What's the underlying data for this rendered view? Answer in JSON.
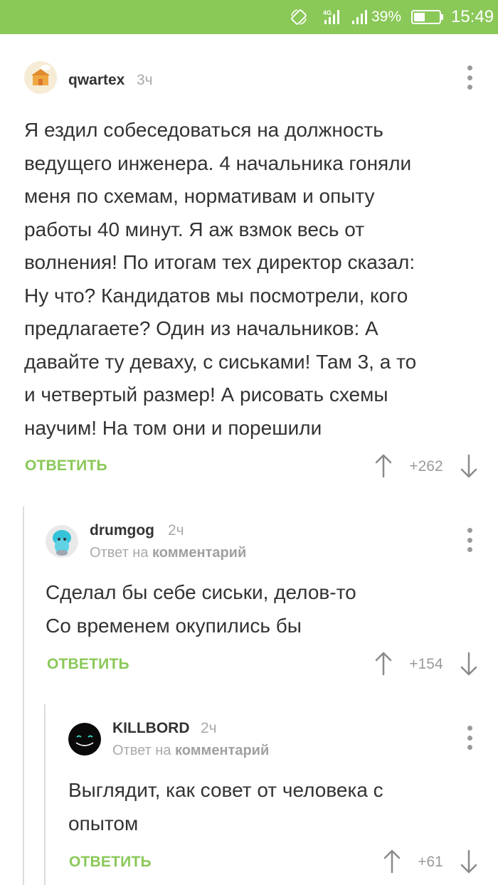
{
  "status_bar": {
    "battery_percent": "39%",
    "time": "15:49",
    "network": "4G",
    "icons": [
      "rotate-icon",
      "network-4g-icon",
      "signal-icon",
      "battery-icon"
    ]
  },
  "colors": {
    "status_bar_bg": "#8ac858",
    "accent_green": "#8ac858",
    "text": "#333333",
    "meta_gray": "#a9a9a9"
  },
  "comments": [
    {
      "author": "qwartex",
      "time": "3ч",
      "avatar": "avatar-qwartex",
      "body_lines": [
        "Я ездил собеседоваться на должность",
        "ведущего инженера. 4 начальника гоняли",
        "меня по схемам, нормативам и опыту",
        "работы 40 минут. Я аж взмок весь от",
        "волнения! По итогам тех директор сказал:",
        "Ну что? Кандидатов мы посмотрели, кого",
        "предлагаете? Один из начальников: А",
        "давайте ту деваху, с сиськами! Там 3, а то",
        "и четвертый размер! А рисовать схемы",
        "научим! На том они и порешили"
      ],
      "reply_label": "ОТВЕТИТЬ",
      "rating": "+262"
    },
    {
      "author": "drumgog",
      "time": "2ч",
      "avatar": "avatar-drumgog",
      "reply_prefix": "Ответ на",
      "reply_target": "комментарий",
      "body_lines": [
        "Сделал бы себе сиськи, делов-то",
        "Со временем окупились бы"
      ],
      "reply_label": "ОТВЕТИТЬ",
      "rating": "+154"
    },
    {
      "author": "KILLBORD",
      "time": "2ч",
      "avatar": "avatar-killbord",
      "reply_prefix": "Ответ на",
      "reply_target": "комментарий",
      "body_lines": [
        "Выглядит, как совет от человека с",
        "опытом"
      ],
      "reply_label": "ОТВЕТИТЬ",
      "rating": "+61"
    }
  ]
}
